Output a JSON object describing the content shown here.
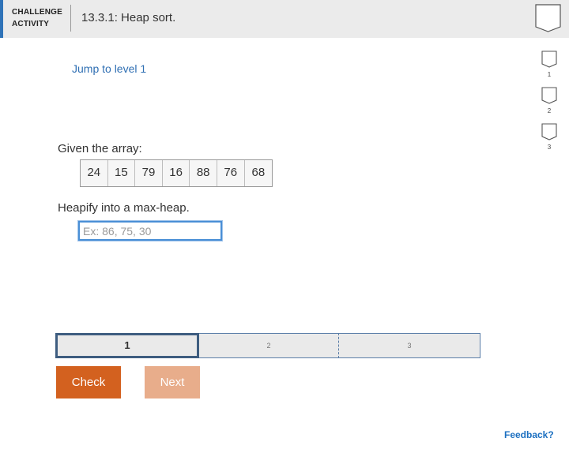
{
  "header": {
    "activity_line1": "CHALLENGE",
    "activity_line2": "ACTIVITY",
    "title": "13.3.1: Heap sort.",
    "accent_color": "#2f73b8",
    "badge_icon": "shield-outline-icon"
  },
  "jump_link": "Jump to level 1",
  "levels": [
    {
      "label": "1",
      "icon": "level-shield-icon"
    },
    {
      "label": "2",
      "icon": "level-shield-icon"
    },
    {
      "label": "3",
      "icon": "level-shield-icon"
    }
  ],
  "prompt": {
    "given_text": "Given the array:",
    "array": [
      "24",
      "15",
      "79",
      "16",
      "88",
      "76",
      "68"
    ],
    "instruction": "Heapify into a max-heap.",
    "input_value": "",
    "input_placeholder": "Ex: 86, 75, 30"
  },
  "progress": {
    "segments": [
      "1",
      "2",
      "3"
    ],
    "active_index": 0
  },
  "buttons": {
    "check_label": "Check",
    "next_label": "Next",
    "check_color": "#d3611f",
    "next_color": "#e8ad8b"
  },
  "feedback_link": "Feedback?"
}
